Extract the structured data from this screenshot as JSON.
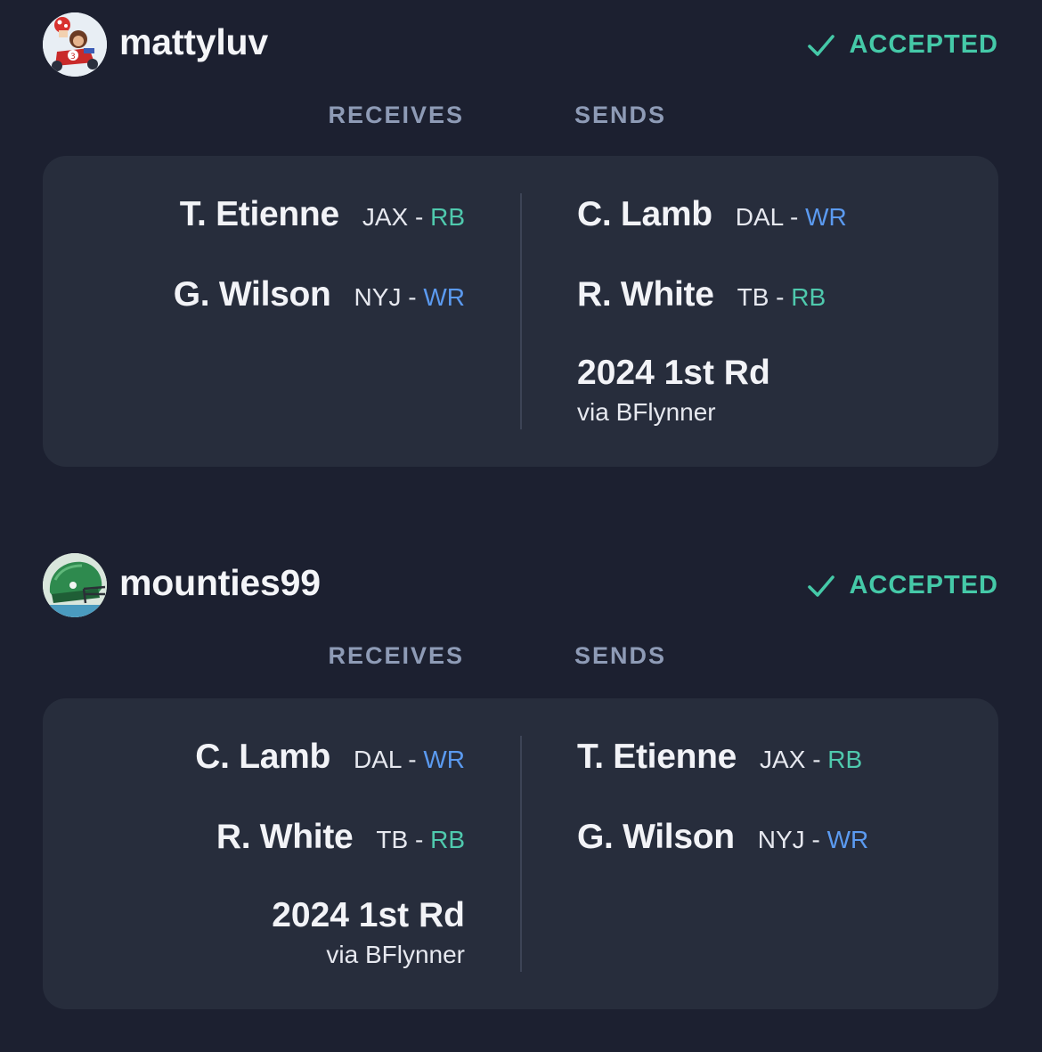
{
  "colors": {
    "background": "#1c2030",
    "card": "#272d3c",
    "accepted": "#45c9a8",
    "rb": "#4fc9ad",
    "wr": "#5b9af0",
    "column_header": "#8e9bb6"
  },
  "parties": [
    {
      "username": "mattyluv",
      "avatar_icon": "kart-racer-avatar-icon",
      "status": "ACCEPTED",
      "receives_label": "RECEIVES",
      "sends_label": "SENDS",
      "receives": [
        {
          "name": "T. Etienne",
          "team": "JAX",
          "sep": "-",
          "pos": "RB"
        },
        {
          "name": "G. Wilson",
          "team": "NYJ",
          "sep": "-",
          "pos": "WR"
        }
      ],
      "sends": [
        {
          "name": "C. Lamb",
          "team": "DAL",
          "sep": "-",
          "pos": "WR"
        },
        {
          "name": "R. White",
          "team": "TB",
          "sep": "-",
          "pos": "RB"
        }
      ],
      "sends_pick": {
        "title": "2024 1st Rd",
        "via": "via BFlynner"
      }
    },
    {
      "username": "mounties99",
      "avatar_icon": "green-helmet-avatar-icon",
      "status": "ACCEPTED",
      "receives_label": "RECEIVES",
      "sends_label": "SENDS",
      "receives": [
        {
          "name": "C. Lamb",
          "team": "DAL",
          "sep": "-",
          "pos": "WR"
        },
        {
          "name": "R. White",
          "team": "TB",
          "sep": "-",
          "pos": "RB"
        }
      ],
      "receives_pick": {
        "title": "2024 1st Rd",
        "via": "via BFlynner"
      },
      "sends": [
        {
          "name": "T. Etienne",
          "team": "JAX",
          "sep": "-",
          "pos": "RB"
        },
        {
          "name": "G. Wilson",
          "team": "NYJ",
          "sep": "-",
          "pos": "WR"
        }
      ]
    }
  ]
}
